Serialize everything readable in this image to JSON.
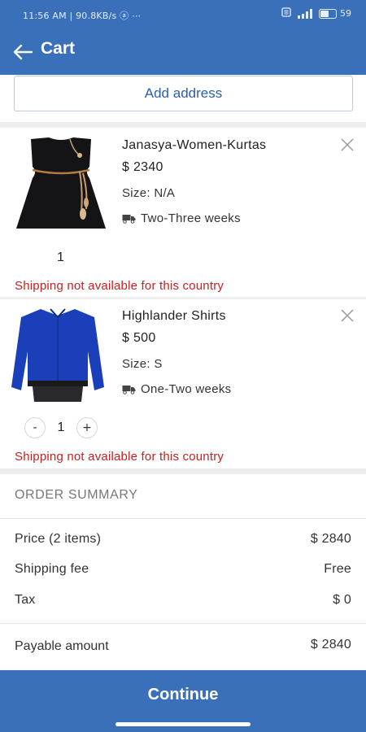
{
  "status_bar": {
    "left_text": "11:56 AM | 90.8KB/s ⓐ ⋯",
    "battery_text": "59",
    "battery_level": 0.59
  },
  "header": {
    "title": "Cart",
    "back_icon": "arrow-left-icon",
    "color": "#3a6fba"
  },
  "address": {
    "button_label": "Add address"
  },
  "items": [
    {
      "name": "Janasya-Women-Kurtas",
      "price": "$ 2340",
      "size": "Size: N/A",
      "delivery": "Two-Three weeks",
      "quantity": "1",
      "warning": "Shipping not available for this country"
    },
    {
      "name": "Highlander Shirts",
      "price": "$ 500",
      "size": "Size: S",
      "delivery": "One-Two weeks",
      "quantity": "1",
      "minus": "-",
      "plus": "+",
      "warning": "Shipping not available for this country"
    }
  ],
  "summary": {
    "title": "ORDER SUMMARY",
    "price_label": "Price (2 items)",
    "price_value": "$ 2840",
    "shipping_label": "Shipping fee",
    "shipping_value": "Free",
    "tax_label": "Tax",
    "tax_value": "$ 0",
    "payable_label": "Payable amount",
    "payable_value": "$ 2840"
  },
  "footer": {
    "continue_label": "Continue"
  },
  "colors": {
    "primary": "#3a6fba",
    "warning": "#c62121"
  }
}
